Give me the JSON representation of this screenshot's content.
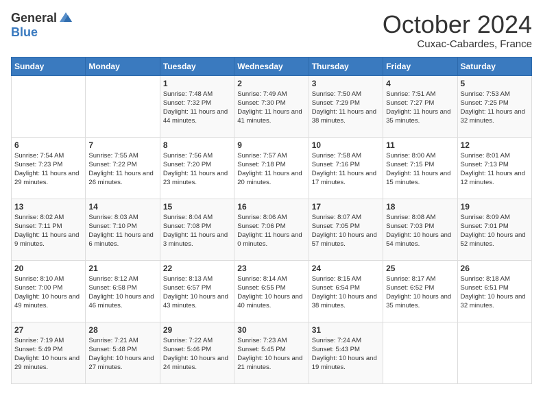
{
  "header": {
    "logo_general": "General",
    "logo_blue": "Blue",
    "month_title": "October 2024",
    "subtitle": "Cuxac-Cabardes, France"
  },
  "weekdays": [
    "Sunday",
    "Monday",
    "Tuesday",
    "Wednesday",
    "Thursday",
    "Friday",
    "Saturday"
  ],
  "weeks": [
    [
      {
        "day": "",
        "sunrise": "",
        "sunset": "",
        "daylight": ""
      },
      {
        "day": "",
        "sunrise": "",
        "sunset": "",
        "daylight": ""
      },
      {
        "day": "1",
        "sunrise": "Sunrise: 7:48 AM",
        "sunset": "Sunset: 7:32 PM",
        "daylight": "Daylight: 11 hours and 44 minutes."
      },
      {
        "day": "2",
        "sunrise": "Sunrise: 7:49 AM",
        "sunset": "Sunset: 7:30 PM",
        "daylight": "Daylight: 11 hours and 41 minutes."
      },
      {
        "day": "3",
        "sunrise": "Sunrise: 7:50 AM",
        "sunset": "Sunset: 7:29 PM",
        "daylight": "Daylight: 11 hours and 38 minutes."
      },
      {
        "day": "4",
        "sunrise": "Sunrise: 7:51 AM",
        "sunset": "Sunset: 7:27 PM",
        "daylight": "Daylight: 11 hours and 35 minutes."
      },
      {
        "day": "5",
        "sunrise": "Sunrise: 7:53 AM",
        "sunset": "Sunset: 7:25 PM",
        "daylight": "Daylight: 11 hours and 32 minutes."
      }
    ],
    [
      {
        "day": "6",
        "sunrise": "Sunrise: 7:54 AM",
        "sunset": "Sunset: 7:23 PM",
        "daylight": "Daylight: 11 hours and 29 minutes."
      },
      {
        "day": "7",
        "sunrise": "Sunrise: 7:55 AM",
        "sunset": "Sunset: 7:22 PM",
        "daylight": "Daylight: 11 hours and 26 minutes."
      },
      {
        "day": "8",
        "sunrise": "Sunrise: 7:56 AM",
        "sunset": "Sunset: 7:20 PM",
        "daylight": "Daylight: 11 hours and 23 minutes."
      },
      {
        "day": "9",
        "sunrise": "Sunrise: 7:57 AM",
        "sunset": "Sunset: 7:18 PM",
        "daylight": "Daylight: 11 hours and 20 minutes."
      },
      {
        "day": "10",
        "sunrise": "Sunrise: 7:58 AM",
        "sunset": "Sunset: 7:16 PM",
        "daylight": "Daylight: 11 hours and 17 minutes."
      },
      {
        "day": "11",
        "sunrise": "Sunrise: 8:00 AM",
        "sunset": "Sunset: 7:15 PM",
        "daylight": "Daylight: 11 hours and 15 minutes."
      },
      {
        "day": "12",
        "sunrise": "Sunrise: 8:01 AM",
        "sunset": "Sunset: 7:13 PM",
        "daylight": "Daylight: 11 hours and 12 minutes."
      }
    ],
    [
      {
        "day": "13",
        "sunrise": "Sunrise: 8:02 AM",
        "sunset": "Sunset: 7:11 PM",
        "daylight": "Daylight: 11 hours and 9 minutes."
      },
      {
        "day": "14",
        "sunrise": "Sunrise: 8:03 AM",
        "sunset": "Sunset: 7:10 PM",
        "daylight": "Daylight: 11 hours and 6 minutes."
      },
      {
        "day": "15",
        "sunrise": "Sunrise: 8:04 AM",
        "sunset": "Sunset: 7:08 PM",
        "daylight": "Daylight: 11 hours and 3 minutes."
      },
      {
        "day": "16",
        "sunrise": "Sunrise: 8:06 AM",
        "sunset": "Sunset: 7:06 PM",
        "daylight": "Daylight: 11 hours and 0 minutes."
      },
      {
        "day": "17",
        "sunrise": "Sunrise: 8:07 AM",
        "sunset": "Sunset: 7:05 PM",
        "daylight": "Daylight: 10 hours and 57 minutes."
      },
      {
        "day": "18",
        "sunrise": "Sunrise: 8:08 AM",
        "sunset": "Sunset: 7:03 PM",
        "daylight": "Daylight: 10 hours and 54 minutes."
      },
      {
        "day": "19",
        "sunrise": "Sunrise: 8:09 AM",
        "sunset": "Sunset: 7:01 PM",
        "daylight": "Daylight: 10 hours and 52 minutes."
      }
    ],
    [
      {
        "day": "20",
        "sunrise": "Sunrise: 8:10 AM",
        "sunset": "Sunset: 7:00 PM",
        "daylight": "Daylight: 10 hours and 49 minutes."
      },
      {
        "day": "21",
        "sunrise": "Sunrise: 8:12 AM",
        "sunset": "Sunset: 6:58 PM",
        "daylight": "Daylight: 10 hours and 46 minutes."
      },
      {
        "day": "22",
        "sunrise": "Sunrise: 8:13 AM",
        "sunset": "Sunset: 6:57 PM",
        "daylight": "Daylight: 10 hours and 43 minutes."
      },
      {
        "day": "23",
        "sunrise": "Sunrise: 8:14 AM",
        "sunset": "Sunset: 6:55 PM",
        "daylight": "Daylight: 10 hours and 40 minutes."
      },
      {
        "day": "24",
        "sunrise": "Sunrise: 8:15 AM",
        "sunset": "Sunset: 6:54 PM",
        "daylight": "Daylight: 10 hours and 38 minutes."
      },
      {
        "day": "25",
        "sunrise": "Sunrise: 8:17 AM",
        "sunset": "Sunset: 6:52 PM",
        "daylight": "Daylight: 10 hours and 35 minutes."
      },
      {
        "day": "26",
        "sunrise": "Sunrise: 8:18 AM",
        "sunset": "Sunset: 6:51 PM",
        "daylight": "Daylight: 10 hours and 32 minutes."
      }
    ],
    [
      {
        "day": "27",
        "sunrise": "Sunrise: 7:19 AM",
        "sunset": "Sunset: 5:49 PM",
        "daylight": "Daylight: 10 hours and 29 minutes."
      },
      {
        "day": "28",
        "sunrise": "Sunrise: 7:21 AM",
        "sunset": "Sunset: 5:48 PM",
        "daylight": "Daylight: 10 hours and 27 minutes."
      },
      {
        "day": "29",
        "sunrise": "Sunrise: 7:22 AM",
        "sunset": "Sunset: 5:46 PM",
        "daylight": "Daylight: 10 hours and 24 minutes."
      },
      {
        "day": "30",
        "sunrise": "Sunrise: 7:23 AM",
        "sunset": "Sunset: 5:45 PM",
        "daylight": "Daylight: 10 hours and 21 minutes."
      },
      {
        "day": "31",
        "sunrise": "Sunrise: 7:24 AM",
        "sunset": "Sunset: 5:43 PM",
        "daylight": "Daylight: 10 hours and 19 minutes."
      },
      {
        "day": "",
        "sunrise": "",
        "sunset": "",
        "daylight": ""
      },
      {
        "day": "",
        "sunrise": "",
        "sunset": "",
        "daylight": ""
      }
    ]
  ]
}
